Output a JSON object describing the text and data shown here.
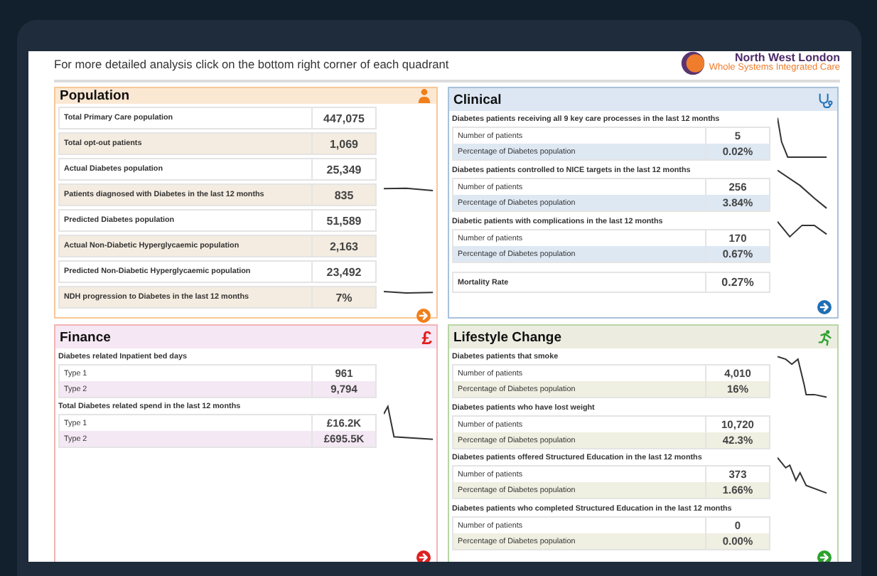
{
  "header": {
    "note": "For more detailed analysis click on the bottom right corner of each quadrant",
    "logo_title": "North West London",
    "logo_subtitle": "Whole Systems Integrated Care"
  },
  "quadrants": [
    {
      "kind": "population",
      "title": "Population",
      "rows": [
        {
          "label": "Total Primary Care population",
          "value": "447,075",
          "trend": false
        },
        {
          "label": "Total opt-out patients",
          "value": "1,069",
          "trend": false
        },
        {
          "label": "Actual Diabetes population",
          "value": "25,349",
          "trend": false
        },
        {
          "label": "Patients diagnosed with Diabetes in the last 12 months",
          "value": "835",
          "trend": true
        },
        {
          "label": "Predicted Diabetes population",
          "value": "51,589",
          "trend": false
        },
        {
          "label": "Actual Non-Diabetic Hyperglycaemic population",
          "value": "2,163",
          "trend": false
        },
        {
          "label": "Predicted Non-Diabetic Hyperglycaemic population",
          "value": "23,492",
          "trend": false
        },
        {
          "label": "NDH progression to Diabetes in the last 12 months",
          "value": "7%",
          "trend": true
        }
      ]
    },
    {
      "kind": "clinical",
      "title": "Clinical",
      "groups": [
        {
          "heading": "Diabetes patients receiving all 9 key care processes in the last 12 months",
          "trend": true,
          "rows": [
            {
              "label": "Number of patients",
              "value": "5"
            },
            {
              "label": "Percentage of Diabetes population",
              "value": "0.02%"
            }
          ]
        },
        {
          "heading": "Diabetes patients controlled to NICE targets in the last 12 months",
          "trend": true,
          "rows": [
            {
              "label": "Number of patients",
              "value": "256"
            },
            {
              "label": "Percentage of Diabetes population",
              "value": "3.84%"
            }
          ]
        },
        {
          "heading": "Diabetic patients with complications in the last 12 months",
          "trend": true,
          "rows": [
            {
              "label": "Number of patients",
              "value": "170"
            },
            {
              "label": "Percentage of Diabetes population",
              "value": "0.67%"
            }
          ]
        }
      ],
      "extra_rows": [
        {
          "label": "Mortality Rate",
          "value": "0.27%"
        }
      ]
    },
    {
      "kind": "finance",
      "title": "Finance",
      "symbol": "£",
      "groups": [
        {
          "heading": "Diabetes related Inpatient bed days",
          "trend": false,
          "rows": [
            {
              "label": "Type 1",
              "value": "961"
            },
            {
              "label": "Type 2",
              "value": "9,794"
            }
          ]
        },
        {
          "heading": "Total Diabetes related spend in the last 12 months",
          "trend": true,
          "rows": [
            {
              "label": "Type 1",
              "value": "£16.2K"
            },
            {
              "label": "Type 2",
              "value": "£695.5K"
            }
          ]
        }
      ]
    },
    {
      "kind": "lifestyle",
      "title": "Lifestyle Change",
      "groups": [
        {
          "heading": "Diabetes patients that smoke",
          "trend": true,
          "rows": [
            {
              "label": "Number of patients",
              "value": "4,010"
            },
            {
              "label": "Percentage of Diabetes population",
              "value": "16%"
            }
          ]
        },
        {
          "heading": "Diabetes patients who have lost weight",
          "trend": false,
          "rows": [
            {
              "label": "Number of patients",
              "value": "10,720"
            },
            {
              "label": "Percentage of Diabetes population",
              "value": "42.3%"
            }
          ]
        },
        {
          "heading": "Diabetes patients offered Structured Education in the last 12 months",
          "trend": true,
          "rows": [
            {
              "label": "Number of patients",
              "value": "373"
            },
            {
              "label": "Percentage of Diabetes population",
              "value": "1.66%"
            }
          ]
        },
        {
          "heading": "Diabetes patients who completed Structured Education in the last 12 months",
          "trend": false,
          "rows": [
            {
              "label": "Number of patients",
              "value": "0"
            },
            {
              "label": "Percentage of Diabetes population",
              "value": "0.00%"
            }
          ]
        }
      ]
    }
  ]
}
